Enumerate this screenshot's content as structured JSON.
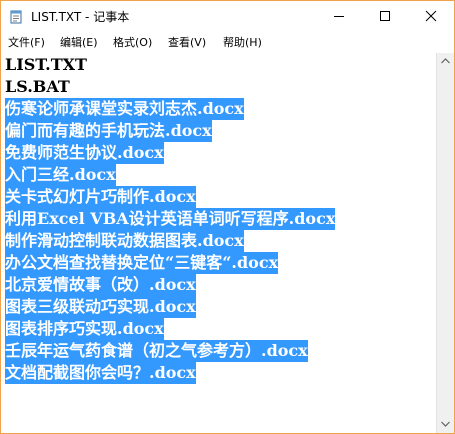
{
  "window": {
    "title": "LIST.TXT - 记事本",
    "app_icon": "notepad-icon"
  },
  "caption_buttons": {
    "minimize_icon": "minimize-icon",
    "maximize_icon": "maximize-icon",
    "close_icon": "close-icon"
  },
  "menu": {
    "items": [
      {
        "label": "文件(F)"
      },
      {
        "label": "编辑(E)"
      },
      {
        "label": "格式(O)"
      },
      {
        "label": "查看(V)"
      },
      {
        "label": "帮助(H)"
      }
    ]
  },
  "editor": {
    "lines": [
      {
        "text": "LIST.TXT",
        "selected": false
      },
      {
        "text": "LS.BAT",
        "selected": false
      },
      {
        "text": "伤寒论师承课堂实录刘志杰.docx",
        "selected": true
      },
      {
        "text": "偏门而有趣的手机玩法.docx",
        "selected": true
      },
      {
        "text": "免费师范生协议.docx",
        "selected": true
      },
      {
        "text": "入门三经.docx",
        "selected": true
      },
      {
        "text": "关卡式幻灯片巧制作.docx",
        "selected": true
      },
      {
        "text": "利用Excel VBA设计英语单词听写程序.docx",
        "selected": true
      },
      {
        "text": "制作滑动控制联动数据图表.docx",
        "selected": true
      },
      {
        "text": "办公文档查找替换定位“三键客“.docx",
        "selected": true
      },
      {
        "text": "北京爱情故事（改）.docx",
        "selected": true
      },
      {
        "text": "图表三级联动巧实现.docx",
        "selected": true
      },
      {
        "text": "图表排序巧实现.docx",
        "selected": true
      },
      {
        "text": "壬辰年运气药食谱（初之气参考方）.docx",
        "selected": true
      },
      {
        "text": "文档配截图你会吗？.docx",
        "selected": true
      }
    ],
    "selection_color": "#3399ff"
  },
  "scrollbar": {
    "up_icon": "scroll-up-arrow-icon",
    "down_icon": "scroll-down-arrow-icon"
  }
}
